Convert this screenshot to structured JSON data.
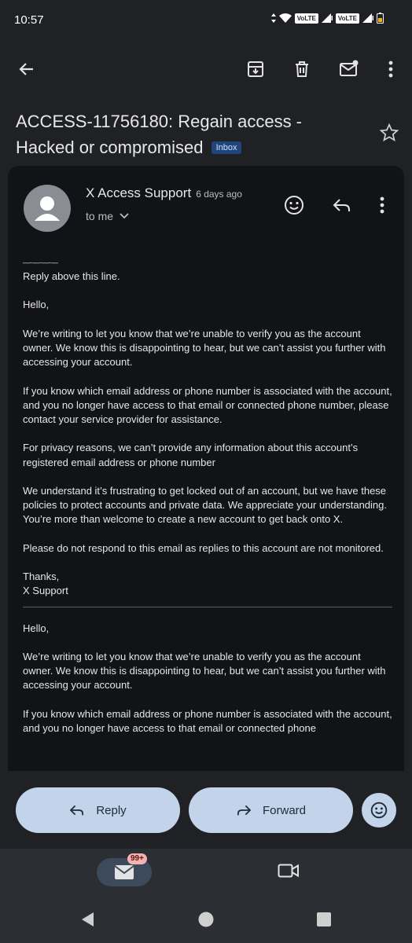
{
  "status_bar": {
    "time": "10:57",
    "volte1": "VoLTE",
    "volte2": "VoLTE"
  },
  "toolbar": {
    "back_icon": "arrow-back-icon",
    "archive_icon": "archive-icon",
    "delete_icon": "trash-icon",
    "mark_unread_icon": "mark-unread-icon",
    "more_icon": "more-vert-icon"
  },
  "email": {
    "subject": "ACCESS-11756180: Regain access - Hacked or compromised",
    "label": "Inbox",
    "sender": "X Access Support",
    "time": "6 days ago",
    "recipient": "to me"
  },
  "body": {
    "dashes": "—-—-—-—",
    "reply_above": "Reply above this line.",
    "greeting": "Hello,",
    "p1": "We’re writing to let you know that we’re unable to verify you as the account owner. We know this is disappointing to hear, but we can’t assist you further with accessing your account.",
    "p2": "If you know which email address or phone number is associated with the account, and you no longer have access to that email or connected phone number, please contact your service provider for assistance.",
    "p3": "For privacy reasons, we can’t provide any information about this account’s registered email address or phone number",
    "p4": "We understand it’s frustrating to get locked out of an account, but we have these policies to protect accounts and private data. We appreciate your understanding.",
    "p4b": "You’re more than welcome to create a new account to get back onto X.",
    "p5": "Please do not respond to this email as replies to this account are not monitored.",
    "thanks": "Thanks,",
    "signature": "X Support",
    "q_greeting": "Hello,",
    "q_p1": "We’re writing to let you know that we’re unable to verify you as the account owner. We know this is disappointing to hear, but we can’t assist you further with accessing your account.",
    "q_p2": "If you know which email address or phone number is associated with the account, and you no longer have access to that email or connected phone"
  },
  "actions": {
    "reply": "Reply",
    "forward": "Forward"
  },
  "nav": {
    "mail_badge": "99+"
  },
  "colors": {
    "background": "#1f2125",
    "card": "#111317",
    "pill": "#c2d3ea",
    "badge": "#20457a"
  }
}
